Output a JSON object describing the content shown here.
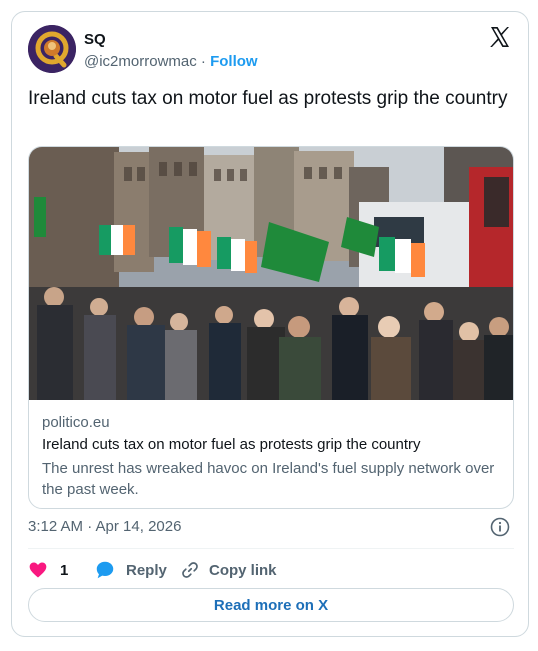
{
  "author": {
    "name": "SQ",
    "handle": "@ic2morrowmac",
    "separator": "·",
    "follow_label": "Follow",
    "avatar_letter": "Q"
  },
  "tweet": {
    "text": "Ireland cuts tax on motor fuel as protests grip the country"
  },
  "link_card": {
    "domain": "politico.eu",
    "title": "Ireland cuts tax on motor fuel as protests grip the country",
    "description": "The unrest has wreaked havoc on Ireland's fuel supply network over the past week.",
    "image_alt": "Crowd of protesters with Irish tricolour and green flags marching past trucks on a city street"
  },
  "meta": {
    "timestamp": "3:12 AM · Apr 14, 2026"
  },
  "actions": {
    "like_count": "1",
    "reply_label": "Reply",
    "copy_link_label": "Copy link"
  },
  "read_more_label": "Read more on X",
  "colors": {
    "accent_blue": "#1d9bf0",
    "like_red": "#f91880",
    "text_primary": "#0f1419",
    "text_secondary": "#536471",
    "border": "#cfd9de"
  },
  "icons": {
    "brand": "x-logo-icon",
    "info": "info-icon",
    "like": "heart-icon",
    "reply": "speech-bubble-icon",
    "copy_link": "link-icon"
  }
}
